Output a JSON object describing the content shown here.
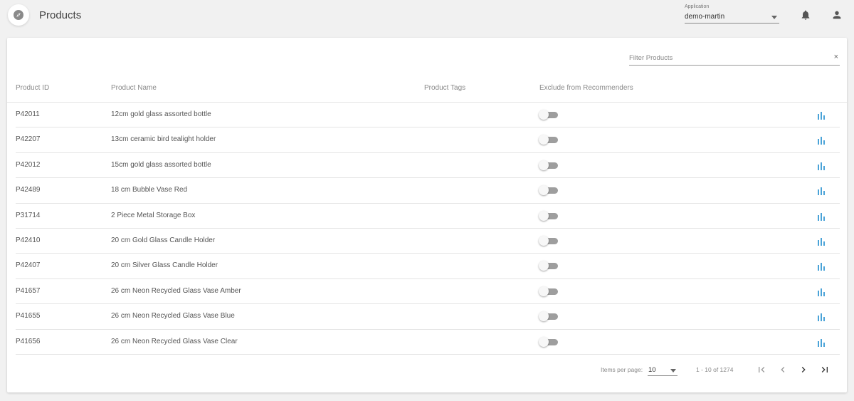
{
  "header": {
    "title": "Products",
    "application_label": "Application",
    "application_value": "demo-martin",
    "logo_icon": "compass-icon",
    "bell_icon": "bell-icon",
    "user_icon": "person-icon"
  },
  "filter": {
    "placeholder": "Filter Products",
    "value": "",
    "clear_glyph": "×"
  },
  "table": {
    "columns": [
      "Product ID",
      "Product Name",
      "Product Tags",
      "Exclude from Recommenders"
    ],
    "rows": [
      {
        "id": "P42011",
        "name": "12cm gold glass assorted bottle",
        "tags": "",
        "excluded": false
      },
      {
        "id": "P42207",
        "name": "13cm ceramic bird tealight holder",
        "tags": "",
        "excluded": false
      },
      {
        "id": "P42012",
        "name": "15cm gold glass assorted bottle",
        "tags": "",
        "excluded": false
      },
      {
        "id": "P42489",
        "name": "18 cm Bubble Vase Red",
        "tags": "",
        "excluded": false
      },
      {
        "id": "P31714",
        "name": "2 Piece Metal Storage Box",
        "tags": "",
        "excluded": false
      },
      {
        "id": "P42410",
        "name": "20 cm Gold Glass Candle Holder",
        "tags": "",
        "excluded": false
      },
      {
        "id": "P42407",
        "name": "20 cm Silver Glass Candle Holder",
        "tags": "",
        "excluded": false
      },
      {
        "id": "P41657",
        "name": "26 cm Neon Recycled Glass Vase Amber",
        "tags": "",
        "excluded": false
      },
      {
        "id": "P41655",
        "name": "26 cm Neon Recycled Glass Vase Blue",
        "tags": "",
        "excluded": false
      },
      {
        "id": "P41656",
        "name": "26 cm Neon Recycled Glass Vase Clear",
        "tags": "",
        "excluded": false
      }
    ],
    "row_action_icon": "bar-chart-icon"
  },
  "paginator": {
    "items_per_page_label": "Items per page:",
    "page_size": "10",
    "range_label": "1 - 10 of 1274"
  },
  "colors": {
    "accent": "#4aa3d8",
    "background": "#f1f1f1",
    "toggle_off": "#9e9e9e"
  }
}
